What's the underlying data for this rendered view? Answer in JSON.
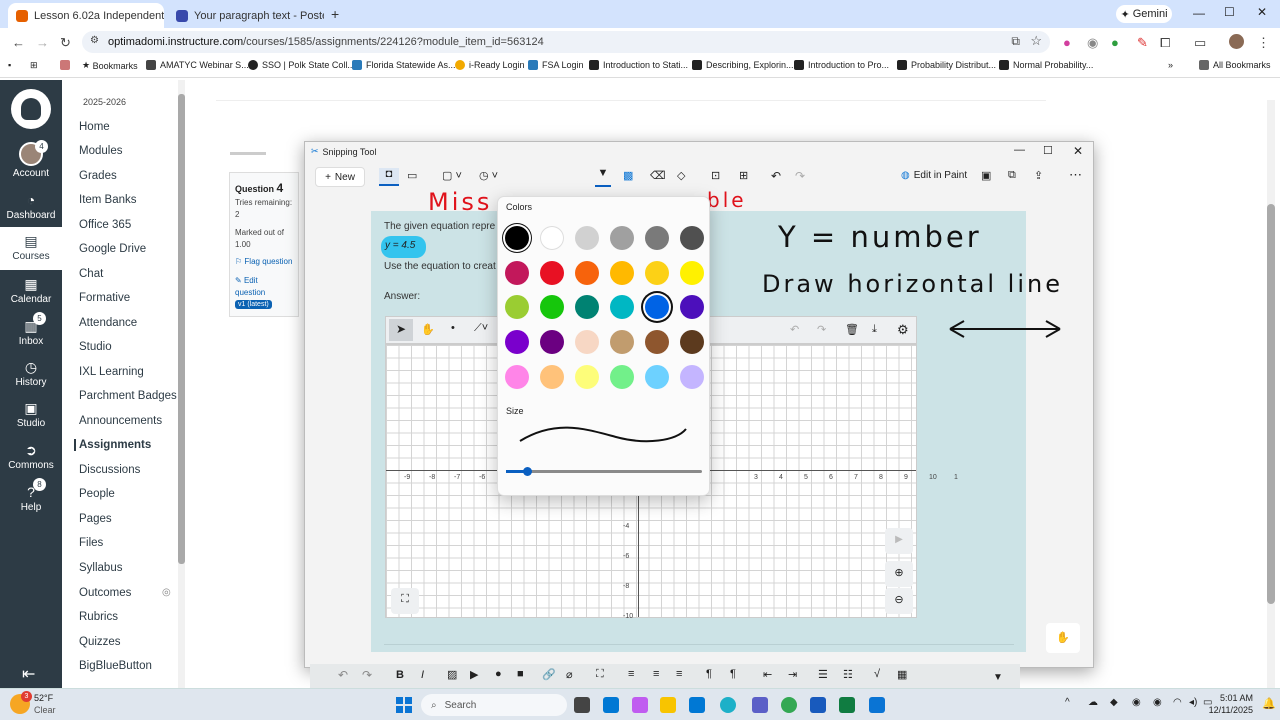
{
  "browser": {
    "tabs": [
      {
        "label": "Lesson 6.02a Independent Prac",
        "active": true
      },
      {
        "label": "Your paragraph text - Poster (L",
        "active": false
      }
    ],
    "url_domain": "optimadomi.instructure.com",
    "url_path": "/courses/1585/assignments/224126?module_item_id=563124",
    "gemini_label": "Gemini",
    "bookmarks": [
      "Bookmarks",
      "AMATYC Webinar S...",
      "SSO | Polk State Coll...",
      "Florida Statewide As...",
      "i-Ready Login",
      "FSA Login",
      "Introduction to Stati...",
      "Describing, Explorin...",
      "Introduction to Pro...",
      "Probability Distribut...",
      "Normal Probability..."
    ],
    "all_bookmarks": "All Bookmarks"
  },
  "global_nav": {
    "items": [
      {
        "label": "Account",
        "badge": "4"
      },
      {
        "label": "Dashboard",
        "badge": ""
      },
      {
        "label": "Courses",
        "badge": ""
      },
      {
        "label": "Calendar",
        "badge": ""
      },
      {
        "label": "Inbox",
        "badge": "5"
      },
      {
        "label": "History",
        "badge": ""
      },
      {
        "label": "Studio",
        "badge": ""
      },
      {
        "label": "Commons",
        "badge": ""
      },
      {
        "label": "Help",
        "badge": "8"
      }
    ]
  },
  "course_nav": {
    "term": "2025-2026",
    "items": [
      "Home",
      "Modules",
      "Grades",
      "Item Banks",
      "Office 365",
      "Google Drive",
      "Chat",
      "Formative",
      "Attendance",
      "Studio",
      "IXL Learning",
      "Parchment Badges",
      "Announcements",
      "Assignments",
      "Discussions",
      "People",
      "Pages",
      "Files",
      "Syllabus",
      "Outcomes",
      "Rubrics",
      "Quizzes",
      "BigBlueButton"
    ],
    "active": "Assignments"
  },
  "question_panel": {
    "title": "Question",
    "number": "4",
    "tries_label": "Tries remaining:",
    "tries_value": "2",
    "marked_label": "Marked out of",
    "marked_value": "1.00",
    "flag_label": "Flag question",
    "edit_label_1": "Edit",
    "edit_label_2": "question",
    "version_badge": "v1 (latest)"
  },
  "snipping_tool": {
    "title": "Snipping Tool",
    "new_label": "New",
    "edit_in_paint": "Edit in Paint",
    "question_text": "The given equation repre",
    "equation": "y = 4.5",
    "instruction": "Use the equation to creat",
    "answer_label": "Answer:",
    "handwriting": {
      "top_partial_1": "Miss",
      "top_partial_2": "ble",
      "line1": "Y = number",
      "line2": "Draw horizontal line"
    },
    "x_ticks": [
      "-9",
      "-8",
      "-7",
      "-6",
      "",
      "",
      "",
      "",
      "",
      "",
      "",
      "",
      "",
      "",
      "3",
      "4",
      "5",
      "6",
      "7",
      "8",
      "9",
      "10",
      "1"
    ],
    "y_ticks": [
      "-4",
      "-6",
      "-8",
      "-10"
    ],
    "colors_heading": "Colors",
    "size_heading": "Size",
    "palette": [
      [
        "#000000",
        "#ffffff",
        "#d1d1d1",
        "#a0a0a0",
        "#7a7a7a",
        "#505050"
      ],
      [
        "#c2185b",
        "#e81123",
        "#f7630c",
        "#ffb900",
        "#fcd116",
        "#fff100"
      ],
      [
        "#9acd32",
        "#16c60c",
        "#008272",
        "#00b7c3",
        "#0063e5",
        "#4c0fbb"
      ],
      [
        "#7a00cc",
        "#6b0081",
        "#f7d7c4",
        "#c19c6e",
        "#8e562e",
        "#5c3a1e"
      ],
      [
        "#ff85e8",
        "#ffc27a",
        "#fdfd7a",
        "#72f08a",
        "#6dd1ff",
        "#c4b5ff"
      ]
    ],
    "selected_color": "#0063e5"
  },
  "taskbar": {
    "weather_temp": "52°F",
    "weather_desc": "Clear",
    "weather_badge": "3",
    "search_placeholder": "Search",
    "time": "5:01 AM",
    "date": "12/11/2025"
  }
}
